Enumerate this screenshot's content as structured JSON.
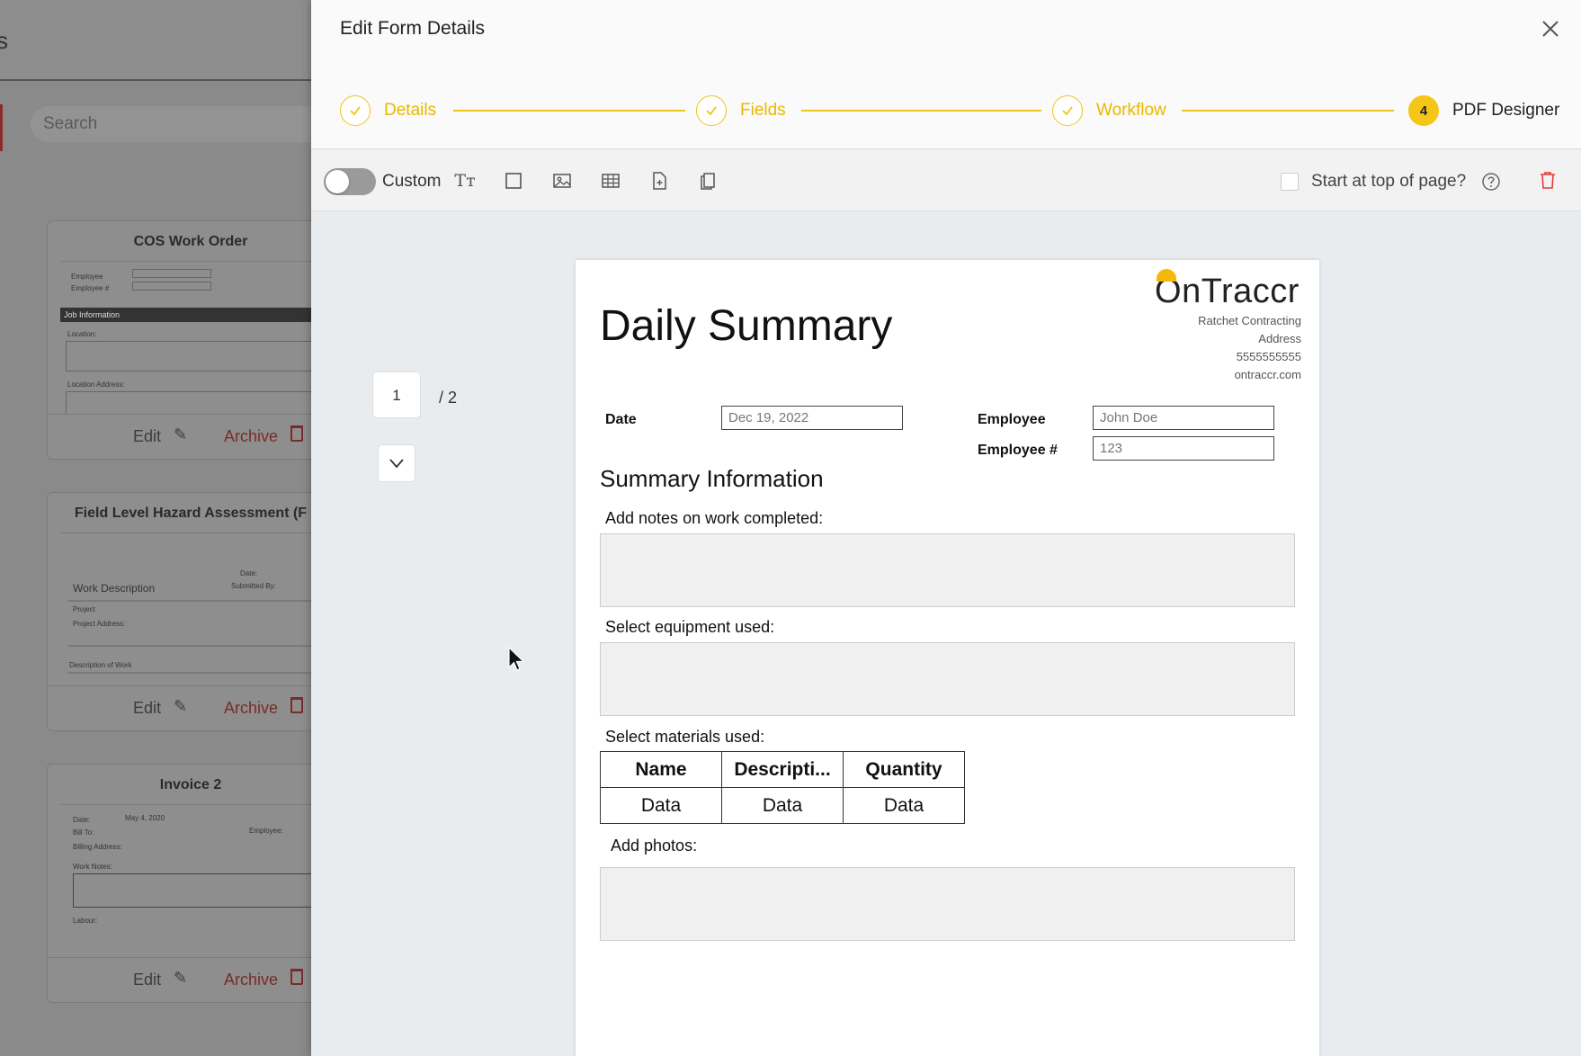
{
  "background": {
    "header_letter": "s",
    "search_placeholder": "Search",
    "cards": [
      {
        "title": "COS Work Order",
        "edit": "Edit",
        "archive": "Archive",
        "preview": {
          "employee": "Employee",
          "employee_num": "Employee #",
          "section": "Job Information",
          "location": "Location:",
          "location_address": "Location Address:"
        }
      },
      {
        "title": "Field Level Hazard Assessment (F",
        "edit": "Edit",
        "archive": "Archive",
        "preview": {
          "date": "Date:",
          "submitted_by": "Submitted By:",
          "work_description": "Work Description",
          "project": "Project",
          "project_address": "Project Address:",
          "description": "Description of Work"
        }
      },
      {
        "title": "Invoice 2",
        "edit": "Edit",
        "archive": "Archive",
        "preview": {
          "date": "Date:",
          "date_val": "May 4, 2020",
          "bill_to": "Bill To:",
          "billing_address": "Billing Address:",
          "employee": "Employee:",
          "work_notes": "Work Notes:",
          "labour": "Labour:"
        }
      }
    ]
  },
  "drawer": {
    "title": "Edit Form Details",
    "steps": [
      {
        "label": "Details",
        "state": "done"
      },
      {
        "label": "Fields",
        "state": "done"
      },
      {
        "label": "Workflow",
        "state": "done"
      },
      {
        "label": "PDF Designer",
        "state": "active",
        "number": "4"
      }
    ],
    "toolbar": {
      "custom_label": "Custom",
      "text_tool": "Tт",
      "start_at_top_label": "Start at top of page?"
    },
    "pager": {
      "current": "1",
      "total": "/ 2"
    }
  },
  "pdf": {
    "title": "Daily Summary",
    "logo": {
      "o": "O",
      "rest": "nTraccr"
    },
    "company": [
      "Ratchet Contracting",
      "Address",
      "5555555555",
      "ontraccr.com"
    ],
    "date_label": "Date",
    "date_value": "Dec 19, 2022",
    "employee_label": "Employee",
    "employee_value": "John Doe",
    "employee_num_label": "Employee #",
    "employee_num_value": "123",
    "section_title": "Summary Information",
    "notes_label": "Add notes on work completed:",
    "equipment_label": "Select equipment used:",
    "materials_label": "Select materials used:",
    "materials_table": {
      "headers": [
        "Name",
        "Descripti...",
        "Quantity"
      ],
      "row": [
        "Data",
        "Data",
        "Data"
      ]
    },
    "photos_label": "Add photos:"
  },
  "colors": {
    "accent": "#f0c419",
    "danger": "#e53935"
  }
}
